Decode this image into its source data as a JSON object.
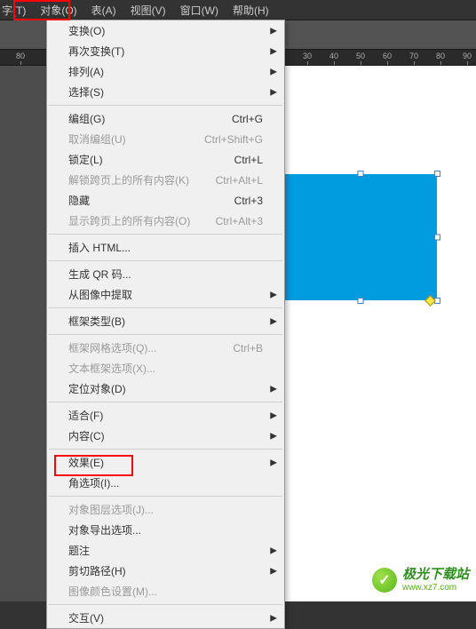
{
  "menubar": {
    "items": [
      "字(T)",
      "对象(O)",
      "表(A)",
      "视图(V)",
      "窗口(W)",
      "帮助(H)"
    ]
  },
  "ruler": {
    "values": [
      "80",
      "30",
      "40",
      "50",
      "60",
      "70",
      "80",
      "90"
    ]
  },
  "dropdown": {
    "sections": [
      [
        {
          "label": "变换(O)",
          "shortcut": "",
          "arrow": true,
          "disabled": false
        },
        {
          "label": "再次变换(T)",
          "shortcut": "",
          "arrow": true,
          "disabled": false
        },
        {
          "label": "排列(A)",
          "shortcut": "",
          "arrow": true,
          "disabled": false
        },
        {
          "label": "选择(S)",
          "shortcut": "",
          "arrow": true,
          "disabled": false
        }
      ],
      [
        {
          "label": "编组(G)",
          "shortcut": "Ctrl+G",
          "arrow": false,
          "disabled": false
        },
        {
          "label": "取消编组(U)",
          "shortcut": "Ctrl+Shift+G",
          "arrow": false,
          "disabled": true
        },
        {
          "label": "锁定(L)",
          "shortcut": "Ctrl+L",
          "arrow": false,
          "disabled": false
        },
        {
          "label": "解锁跨页上的所有内容(K)",
          "shortcut": "Ctrl+Alt+L",
          "arrow": false,
          "disabled": true
        },
        {
          "label": "隐藏",
          "shortcut": "Ctrl+3",
          "arrow": false,
          "disabled": false
        },
        {
          "label": "显示跨页上的所有内容(O)",
          "shortcut": "Ctrl+Alt+3",
          "arrow": false,
          "disabled": true
        }
      ],
      [
        {
          "label": "插入 HTML...",
          "shortcut": "",
          "arrow": false,
          "disabled": false
        }
      ],
      [
        {
          "label": "生成 QR 码...",
          "shortcut": "",
          "arrow": false,
          "disabled": false
        },
        {
          "label": "从图像中提取",
          "shortcut": "",
          "arrow": true,
          "disabled": false
        }
      ],
      [
        {
          "label": "框架类型(B)",
          "shortcut": "",
          "arrow": true,
          "disabled": false
        }
      ],
      [
        {
          "label": "框架网格选项(Q)...",
          "shortcut": "Ctrl+B",
          "arrow": false,
          "disabled": true
        },
        {
          "label": "文本框架选项(X)...",
          "shortcut": "",
          "arrow": false,
          "disabled": true
        },
        {
          "label": "定位对象(D)",
          "shortcut": "",
          "arrow": true,
          "disabled": false
        }
      ],
      [
        {
          "label": "适合(F)",
          "shortcut": "",
          "arrow": true,
          "disabled": false
        },
        {
          "label": "内容(C)",
          "shortcut": "",
          "arrow": true,
          "disabled": false
        }
      ],
      [
        {
          "label": "效果(E)",
          "shortcut": "",
          "arrow": true,
          "disabled": false
        },
        {
          "label": "角选项(I)...",
          "shortcut": "",
          "arrow": false,
          "disabled": false
        }
      ],
      [
        {
          "label": "对象图层选项(J)...",
          "shortcut": "",
          "arrow": false,
          "disabled": true
        },
        {
          "label": "对象导出选项...",
          "shortcut": "",
          "arrow": false,
          "disabled": false
        },
        {
          "label": "题注",
          "shortcut": "",
          "arrow": true,
          "disabled": false
        },
        {
          "label": "剪切路径(H)",
          "shortcut": "",
          "arrow": true,
          "disabled": false
        },
        {
          "label": "图像颜色设置(M)...",
          "shortcut": "",
          "arrow": false,
          "disabled": true
        }
      ],
      [
        {
          "label": "交互(V)",
          "shortcut": "",
          "arrow": true,
          "disabled": false
        }
      ]
    ]
  },
  "watermark": {
    "glyph": "✓",
    "title": "极光下载站",
    "url": "www.xz7.com"
  },
  "colors": {
    "canvas_blue": "#019cdf",
    "highlight_red": "#ff0000"
  }
}
